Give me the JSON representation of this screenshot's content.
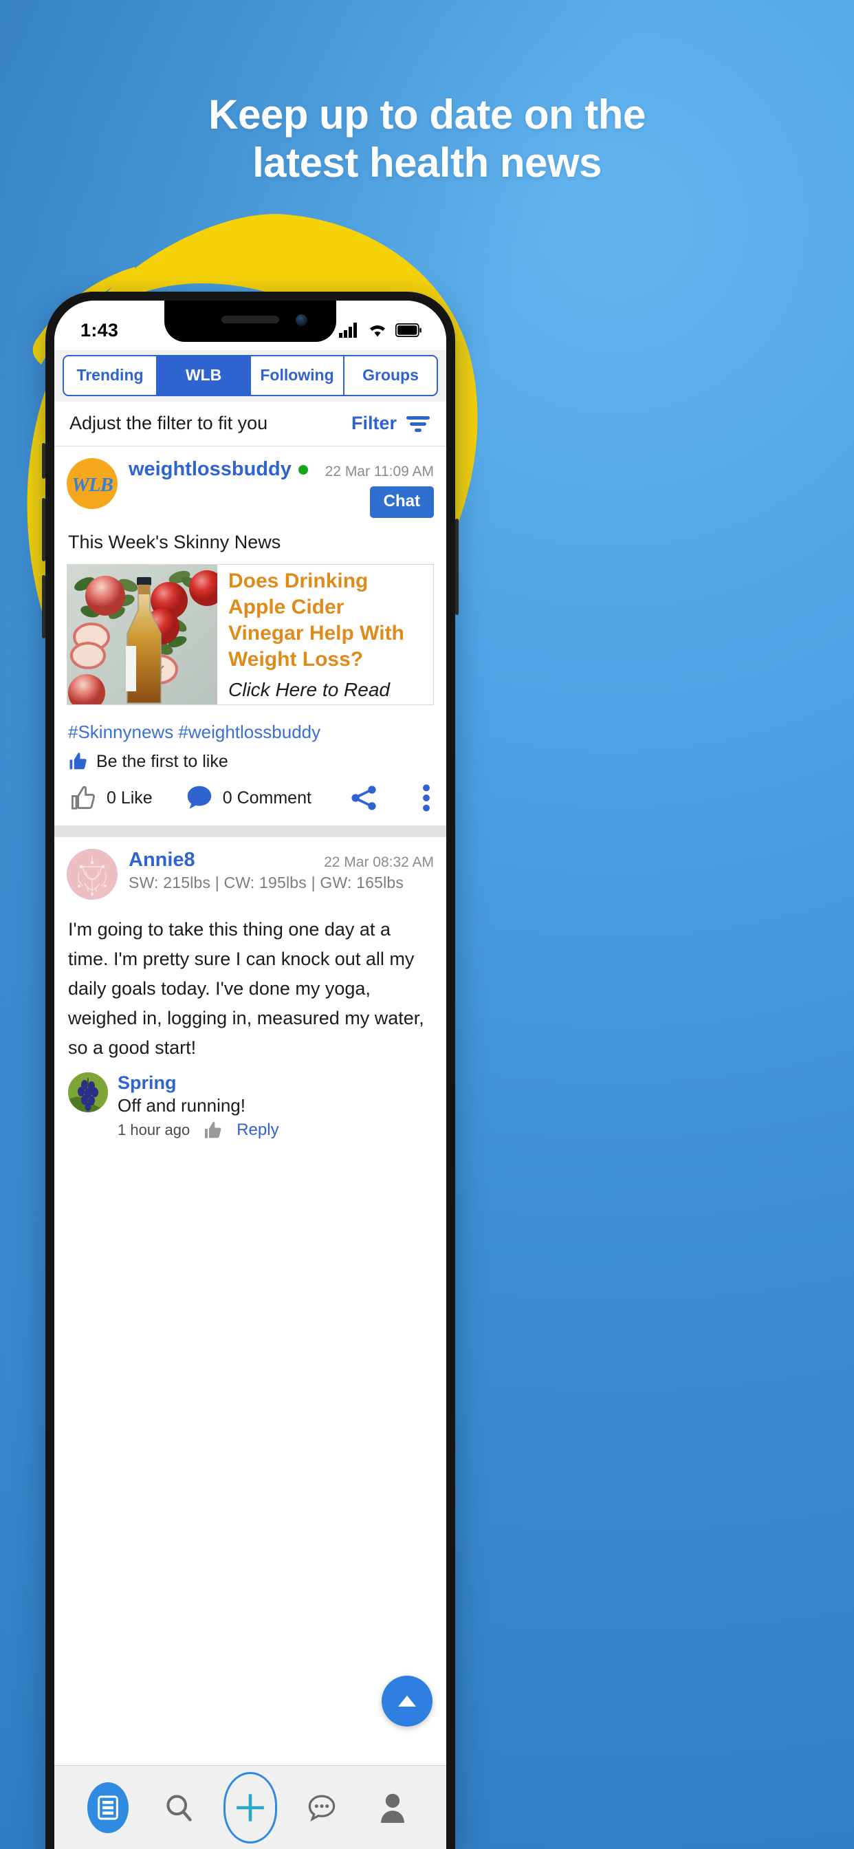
{
  "promo": {
    "headline_line1": "Keep up to date on the",
    "headline_line2": "latest health news",
    "brand_yellow": "#f5d208",
    "bg_blue": "#4ea3e4"
  },
  "statusbar": {
    "time": "1:43",
    "signal_icon": "cellular-signal-icon",
    "wifi_icon": "wifi-icon",
    "battery_icon": "battery-icon"
  },
  "tabs": [
    {
      "label": "Trending",
      "active": false
    },
    {
      "label": "WLB",
      "active": true
    },
    {
      "label": "Following",
      "active": false
    },
    {
      "label": "Groups",
      "active": false
    }
  ],
  "filter": {
    "hint": "Adjust the filter to fit you",
    "label": "Filter",
    "icon": "filter-icon"
  },
  "posts": [
    {
      "username": "weightlossbuddy",
      "avatar_text": "WLB",
      "avatar_color": "#f5a81c",
      "online": true,
      "timestamp": "22 Mar 11:09 AM",
      "chat_label": "Chat",
      "title": "This Week's Skinny News",
      "article": {
        "title": "Does Drinking Apple Cider Vinegar Help With Weight Loss?",
        "cta": "Click Here to Read",
        "image_alt": "apples-and-cider-vinegar-bottle"
      },
      "hashtags": "#Skinnynews #weightlossbuddy",
      "like_hint": "Be the first to like",
      "like_count": "0 Like",
      "comment_count": "0 Comment",
      "share_icon": "share-icon",
      "menu_icon": "more-vertical-icon"
    },
    {
      "username": "Annie8",
      "avatar_color": "#edbec3",
      "timestamp": "22 Mar 08:32 AM",
      "stats": "SW: 215lbs | CW: 195lbs | GW: 165lbs",
      "body": "I'm going to take this thing one day at a time. I'm pretty sure I can knock out all my daily goals today.  I've done my yoga, weighed in, logging in, measured my water, so a good start!",
      "comment": {
        "username": "Spring",
        "text": "Off and running!",
        "time": "1 hour ago",
        "like_icon": "thumbs-up-icon",
        "reply_label": "Reply"
      }
    }
  ],
  "fab": {
    "icon": "scroll-to-top-icon"
  },
  "bottomnav": [
    {
      "icon": "feed-icon",
      "active": true
    },
    {
      "icon": "search-icon",
      "active": false
    },
    {
      "icon": "plus-icon",
      "active": false
    },
    {
      "icon": "chat-bubble-icon",
      "active": false
    },
    {
      "icon": "profile-icon",
      "active": false
    }
  ]
}
